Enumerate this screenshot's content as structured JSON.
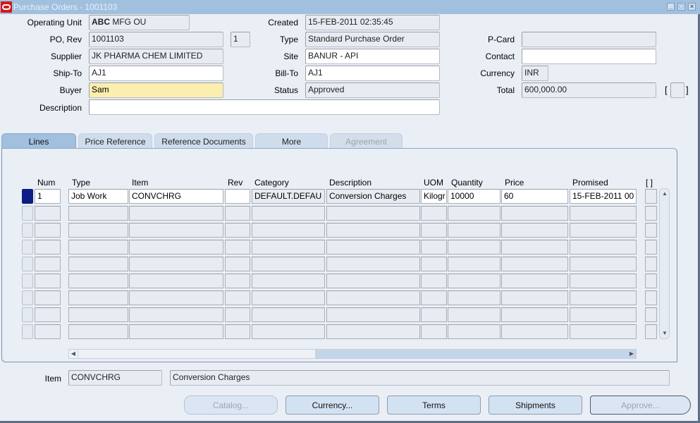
{
  "window": {
    "title": "Purchase Orders - 1001103",
    "controls": [
      "minimize",
      "maximize",
      "close"
    ]
  },
  "header": {
    "operating_unit": {
      "label": "Operating Unit",
      "value_prefix": "ABC",
      "value_rest": " MFG OU"
    },
    "po_rev": {
      "label": "PO, Rev",
      "po": "1001103",
      "rev": "1"
    },
    "supplier": {
      "label": "Supplier",
      "value": "JK PHARMA CHEM LIMITED"
    },
    "ship_to": {
      "label": "Ship-To",
      "value": "AJ1"
    },
    "buyer": {
      "label": "Buyer",
      "value": "Sam"
    },
    "description": {
      "label": "Description",
      "value": ""
    },
    "created": {
      "label": "Created",
      "value": "15-FEB-2011 02:35:45"
    },
    "type": {
      "label": "Type",
      "value": "Standard Purchase Order"
    },
    "site": {
      "label": "Site",
      "value": "BANUR - API"
    },
    "bill_to": {
      "label": "Bill-To",
      "value": "AJ1"
    },
    "status": {
      "label": "Status",
      "value": "Approved"
    },
    "p_card": {
      "label": "P-Card",
      "value": ""
    },
    "contact": {
      "label": "Contact",
      "value": ""
    },
    "currency": {
      "label": "Currency",
      "value": "INR"
    },
    "total": {
      "label": "Total",
      "value": "600,000.00"
    },
    "flex_bracket": "[ ]"
  },
  "tabs": [
    {
      "label": "Lines",
      "state": "active"
    },
    {
      "label": "Price Reference",
      "state": "normal"
    },
    {
      "label": "Reference Documents",
      "state": "normal"
    },
    {
      "label": "More",
      "state": "normal"
    },
    {
      "label": "Agreement",
      "state": "disabled"
    }
  ],
  "lines": {
    "columns": [
      "Num",
      "Type",
      "Item",
      "Rev",
      "Category",
      "Description",
      "UOM",
      "Quantity",
      "Price",
      "Promised",
      "[ ]"
    ],
    "rows": [
      {
        "num": "1",
        "type": "Job Work",
        "item": "CONVCHRG",
        "rev": "",
        "category": "DEFAULT.DEFAU",
        "description": "Conversion Charges",
        "uom": "Kilogr",
        "quantity": "10000",
        "price": "60",
        "promised": "15-FEB-2011 00"
      }
    ],
    "empty_rows": 8
  },
  "footer": {
    "item_label": "Item",
    "item_code": "CONVCHRG",
    "item_description": "Conversion Charges"
  },
  "buttons": {
    "catalog": "Catalog...",
    "currency": "Currency...",
    "terms": "Terms",
    "shipments": "Shipments",
    "approve": "Approve..."
  }
}
